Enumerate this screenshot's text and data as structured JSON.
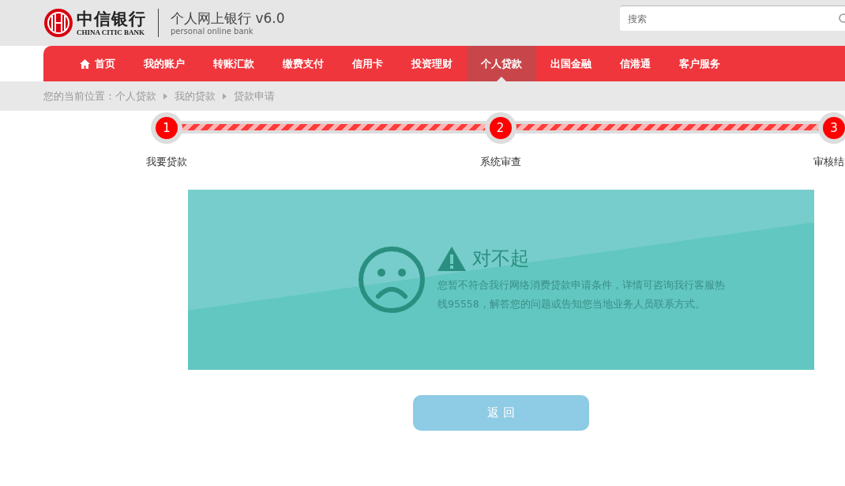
{
  "header": {
    "logo_cn": "中信银行",
    "logo_en": "CHINA CITIC BANK",
    "title": "个人网上银行 v6.0",
    "subtitle": "personal online bank",
    "search": {
      "placeholder": "搜索"
    }
  },
  "nav": [
    {
      "label": "首页",
      "kind": "home",
      "selected": false
    },
    {
      "label": "我的账户",
      "kind": "text",
      "selected": false
    },
    {
      "label": "转账汇款",
      "kind": "text",
      "selected": false
    },
    {
      "label": "缴费支付",
      "kind": "text",
      "selected": false
    },
    {
      "label": "信用卡",
      "kind": "text",
      "selected": false
    },
    {
      "label": "投资理财",
      "kind": "text",
      "selected": false
    },
    {
      "label": "个人贷款",
      "kind": "text",
      "selected": true
    },
    {
      "label": "出国金融",
      "kind": "text",
      "selected": false
    },
    {
      "label": "信港通",
      "kind": "text",
      "selected": false
    },
    {
      "label": "客户服务",
      "kind": "text",
      "selected": false
    }
  ],
  "breadcrumb": {
    "prefix": "您的当前位置：",
    "items": [
      "个人贷款",
      "我的贷款",
      "贷款申请"
    ]
  },
  "steps": [
    {
      "number": "1",
      "label": "我要贷款"
    },
    {
      "number": "2",
      "label": "系统审查"
    },
    {
      "number": "3",
      "label": "审核结"
    }
  ],
  "message": {
    "title": "对不起",
    "text": "您暂不符合我行网络消费贷款申请条件，详情可咨询我行客服热线95558，解答您的问题或告知您当地业务人员联系方式。"
  },
  "button": "返 回"
}
